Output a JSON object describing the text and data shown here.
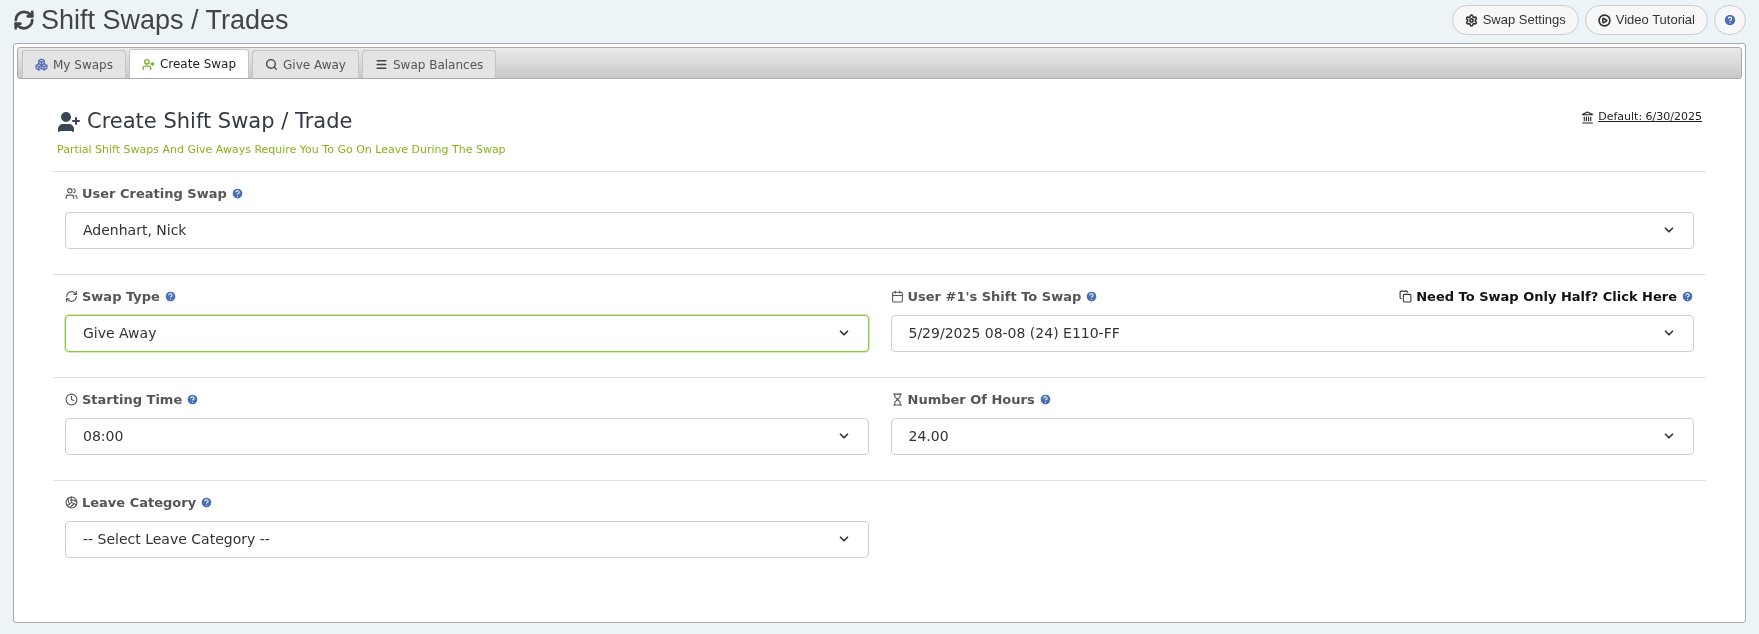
{
  "page_title": "Shift Swaps / Trades",
  "header_buttons": [
    {
      "kind": "settings",
      "label": "Swap Settings"
    },
    {
      "kind": "video",
      "label": "Video Tutorial"
    },
    {
      "kind": "help"
    }
  ],
  "tabs": [
    {
      "label": "My Swaps",
      "selected": false
    },
    {
      "label": "Create Swap",
      "selected": true
    },
    {
      "label": "Give Away",
      "selected": false
    },
    {
      "label": "Swap Balances",
      "selected": false
    }
  ],
  "form": {
    "heading": "Create Shift Swap / Trade",
    "note": "Partial Shift Swaps And Give Aways Require You To Go On Leave During The Swap",
    "default_link": "Default: 6/30/2025",
    "rows": [
      {
        "fields": [
          {
            "kind": "users",
            "label": "User Creating Swap",
            "value": "Adenhart, Nick",
            "focused": false
          }
        ]
      },
      {
        "fields": [
          {
            "kind": "refresh",
            "label": "Swap Type",
            "value": "Give Away",
            "focused": true
          },
          {
            "kind": "calendar",
            "label": "User #1's Shift To Swap",
            "value": "5/29/2025 08-08 (24) E110-FF",
            "focused": false,
            "link": "Need To Swap Only Half? Click Here"
          }
        ]
      },
      {
        "fields": [
          {
            "kind": "clock",
            "label": "Starting Time",
            "value": "08:00",
            "focused": false
          },
          {
            "kind": "hourglass",
            "label": "Number Of Hours",
            "value": "24.00",
            "focused": false
          }
        ]
      },
      {
        "fields": [
          {
            "kind": "ball",
            "label": "Leave Category",
            "value": "-- Select Leave Category --",
            "focused": false
          }
        ]
      }
    ]
  }
}
